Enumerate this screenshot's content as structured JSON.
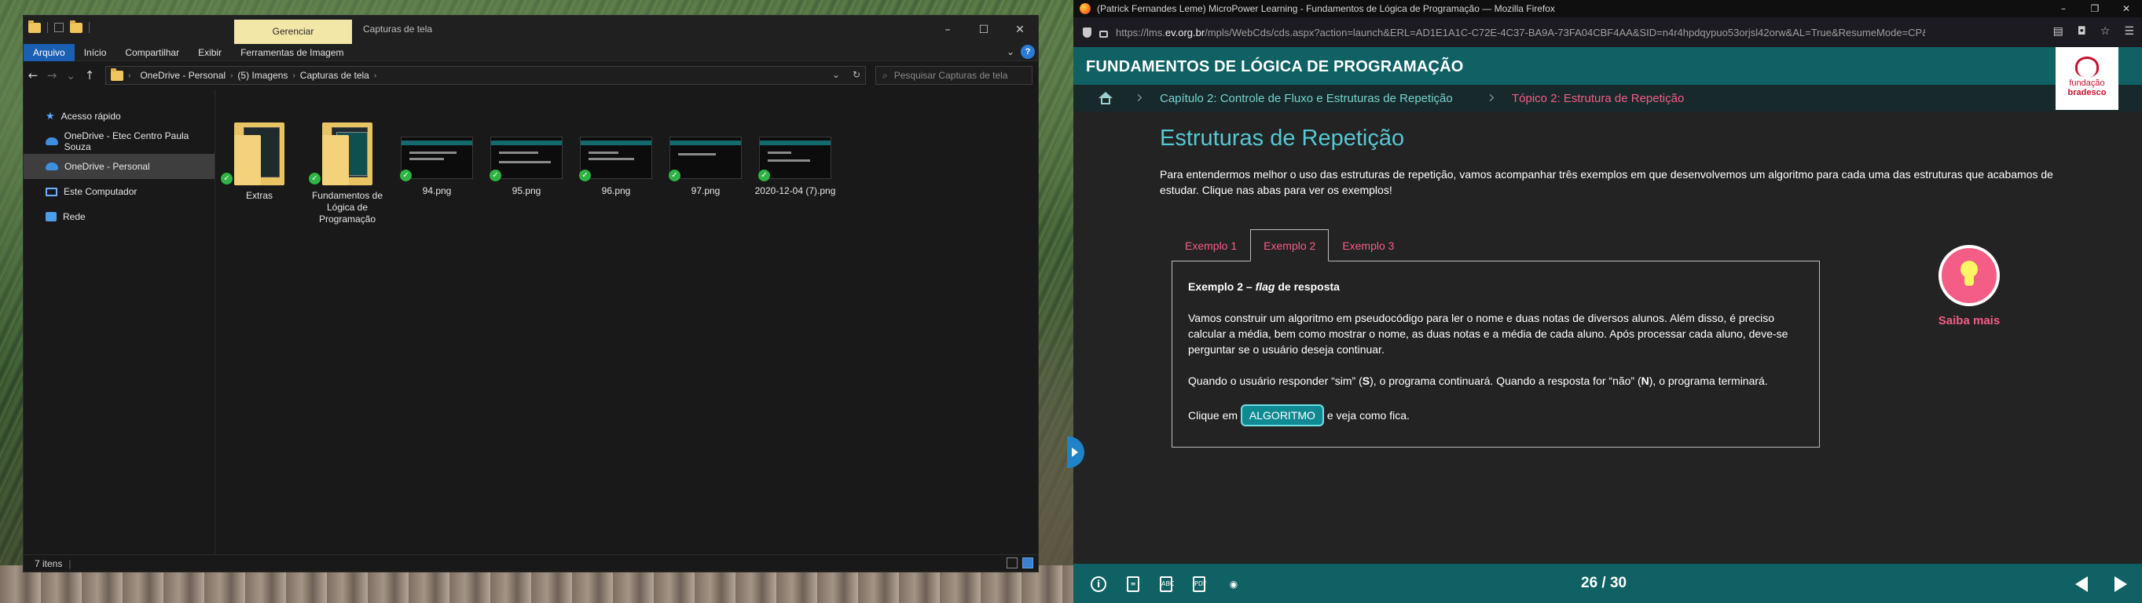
{
  "explorer": {
    "context_tab": "Gerenciar",
    "window_title": "Capturas de tela",
    "ribbon_tabs": [
      "Arquivo",
      "Início",
      "Compartilhar",
      "Exibir",
      "Ferramentas de Imagem"
    ],
    "breadcrumbs": [
      "OneDrive - Personal",
      "(5) Imagens",
      "Capturas de tela"
    ],
    "search_placeholder": "Pesquisar Capturas de tela",
    "nav_items": [
      {
        "label": "Acesso rápido",
        "icon": "star-icon"
      },
      {
        "label": "OneDrive - Etec Centro Paula Souza",
        "icon": "cloud-icon"
      },
      {
        "label": "OneDrive - Personal",
        "icon": "cloud-icon",
        "selected": true
      },
      {
        "label": "Este Computador",
        "icon": "computer-icon"
      },
      {
        "label": "Rede",
        "icon": "network-icon"
      }
    ],
    "files": [
      {
        "name": "Extras",
        "type": "folder"
      },
      {
        "name": "Fundamentos de Lógica de Programação",
        "type": "folder"
      },
      {
        "name": "94.png",
        "type": "image"
      },
      {
        "name": "95.png",
        "type": "image"
      },
      {
        "name": "96.png",
        "type": "image"
      },
      {
        "name": "97.png",
        "type": "image"
      },
      {
        "name": "2020-12-04 (7).png",
        "type": "image"
      }
    ],
    "status": "7 itens"
  },
  "firefox": {
    "window_title": "(Patrick Fernandes Leme) MicroPower Learning - Fundamentos de Lógica de Programação — Mozilla Firefox",
    "url_prefix": "https://lms.",
    "url_domain": "ev.org.br",
    "url_rest": "/mpls/WebCds/cds.aspx?action=launch&ERL=AD1E1A1C-C72E-4C37-BA9A-73FA04CBF4AA&SID=n4r4hpdqypuo53orjsl42orw&AL=True&ResumeMode=CP&DCM=ALL"
  },
  "course": {
    "title": "FUNDAMENTOS DE LÓGICA DE PROGRAMAÇÃO",
    "brand_line1": "fundação",
    "brand_line2": "bradesco",
    "breadcrumb_chapter": "Capítulo 2: Controle de Fluxo e Estruturas de Repetição",
    "breadcrumb_topic": "Tópico 2: Estrutura de Repetição",
    "lesson_title": "Estruturas de Repetição",
    "intro": "Para entendermos melhor o uso das estruturas de repetição, vamos acompanhar três exemplos em que desenvolvemos um algoritmo para cada uma das estruturas que acabamos de estudar. Clique nas abas para ver os exemplos!",
    "tabs": [
      "Exemplo 1",
      "Exemplo 2",
      "Exemplo 3"
    ],
    "panel": {
      "head_prefix": "Exemplo 2 – ",
      "head_italic": "flag",
      "head_suffix": " de resposta",
      "p1": "Vamos construir um algoritmo em pseudocódigo para ler o nome e duas notas de diversos alunos. Além disso, é preciso calcular a média, bem como mostrar o nome, as duas notas e a média de cada aluno. Após processar cada aluno, deve-se perguntar se o usuário deseja continuar.",
      "p2_a": "Quando o usuário responder “sim” (",
      "p2_s": "S",
      "p2_b": "), o programa continuará. Quando a resposta for “não” (",
      "p2_n": "N",
      "p2_c": "), o programa terminará.",
      "click_prefix": "Clique em ",
      "button_label": "ALGORITMO",
      "click_suffix": " e veja como fica."
    },
    "saiba_mais": "Saiba mais",
    "page_counter": "26 / 30"
  }
}
